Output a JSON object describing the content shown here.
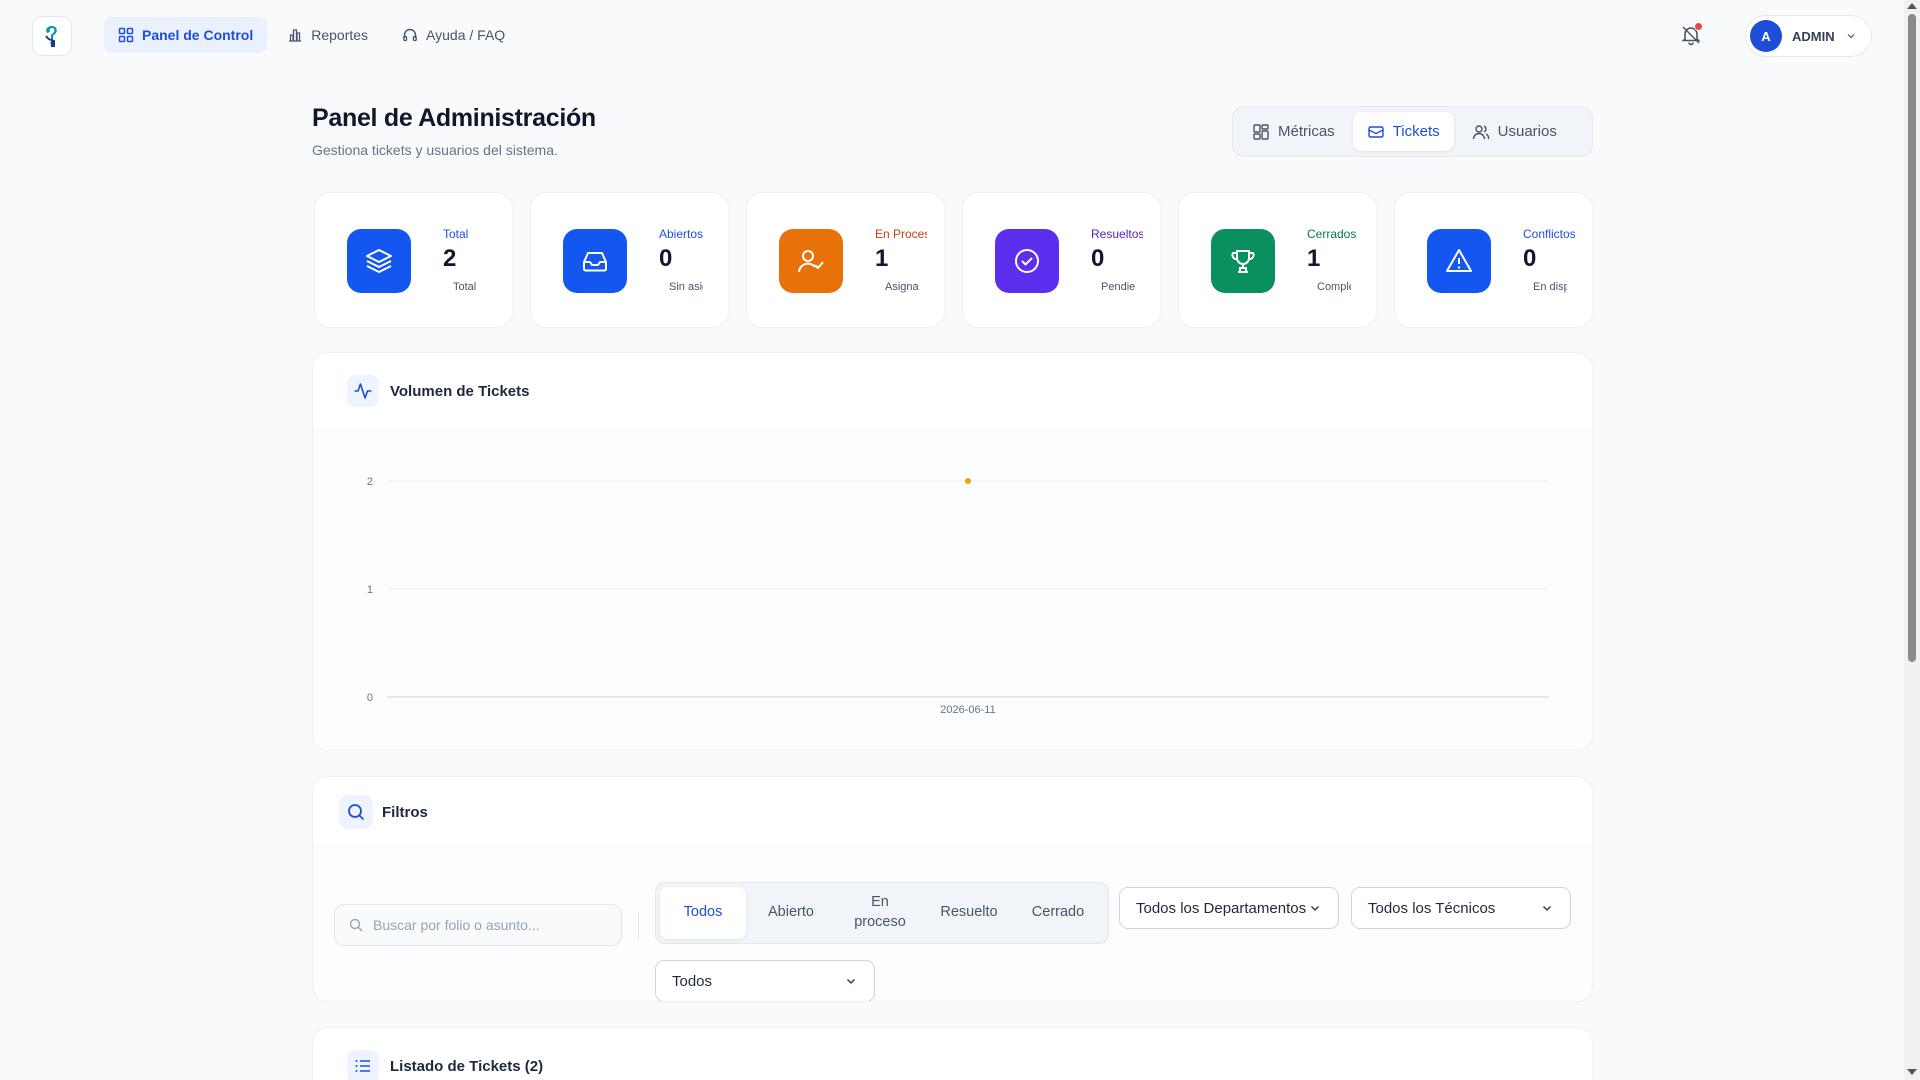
{
  "nav": {
    "items": [
      {
        "label": "Panel de Control",
        "icon": "grid-icon",
        "active": true
      },
      {
        "label": "Reportes",
        "icon": "bar-chart-icon",
        "active": false
      },
      {
        "label": "Ayuda / FAQ",
        "icon": "headphones-icon",
        "active": false
      }
    ],
    "user": {
      "initial": "A",
      "name": "ADMIN"
    }
  },
  "header": {
    "title": "Panel de Administración",
    "subtitle": "Gestiona tickets y usuarios del sistema.",
    "tabs": [
      {
        "label": "Métricas",
        "icon": "layout-icon"
      },
      {
        "label": "Tickets",
        "icon": "ticket-icon"
      },
      {
        "label": "Usuarios",
        "icon": "users-icon"
      }
    ]
  },
  "stats": [
    {
      "label": "Total",
      "value": "2",
      "desc": "Total",
      "color": "#1457f0",
      "label_color": "#1d4ed8",
      "icon": "layers-icon"
    },
    {
      "label": "Abiertos",
      "value": "0",
      "desc": "Sin asignar",
      "color": "#1457f0",
      "label_color": "#1d4ed8",
      "icon": "inbox-icon"
    },
    {
      "label": "En Proceso",
      "value": "1",
      "desc": "Asignados",
      "color": "#e8710a",
      "label_color": "#c2410c",
      "icon": "user-check-icon"
    },
    {
      "label": "Resueltos",
      "value": "0",
      "desc": "Pendientes",
      "color": "#5b2ef0",
      "label_color": "#5b21b6",
      "icon": "check-circle-icon"
    },
    {
      "label": "Cerrados",
      "value": "1",
      "desc": "Completados",
      "color": "#0a8f5f",
      "label_color": "#047857",
      "icon": "trophy-icon"
    },
    {
      "label": "Conflictos",
      "value": "0",
      "desc": "En disputa",
      "color": "#1457f0",
      "label_color": "#1d4ed8",
      "icon": "alert-triangle-icon"
    }
  ],
  "chart_card": {
    "title": "Volumen de Tickets"
  },
  "chart_data": {
    "type": "line",
    "title": "Volumen de Tickets",
    "x": [
      "2026-06-11"
    ],
    "series": [
      {
        "values": [
          2
        ],
        "color": "#f59e0b"
      }
    ],
    "yticks": [
      0,
      1,
      2
    ],
    "ylim": [
      0,
      2
    ],
    "grid": true
  },
  "filters": {
    "title": "Filtros",
    "search_placeholder": "Buscar por folio o asunto...",
    "statuses": [
      "Todos",
      "Abierto",
      "En proceso",
      "Resuelto",
      "Cerrado"
    ],
    "active_status": "Todos",
    "department": "Todos los Departamentos",
    "technician": "Todos los Técnicos",
    "priority": "Todos"
  },
  "list": {
    "title": "Listado de Tickets (2)"
  }
}
